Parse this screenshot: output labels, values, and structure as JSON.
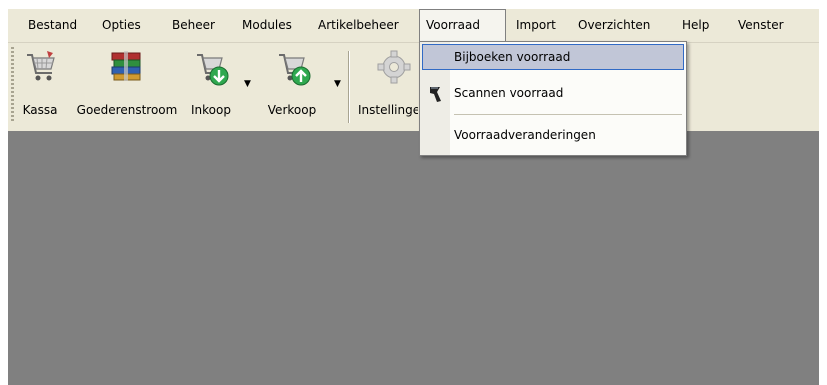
{
  "menubar": {
    "items": [
      {
        "label": "Bestand"
      },
      {
        "label": "Opties"
      },
      {
        "label": "Beheer"
      },
      {
        "label": "Modules"
      },
      {
        "label": "Artikelbeheer"
      },
      {
        "label": "Voorraad"
      },
      {
        "label": "Import"
      },
      {
        "label": "Overzichten"
      },
      {
        "label": "Help"
      },
      {
        "label": "Venster"
      }
    ],
    "open_menu": "Voorraad"
  },
  "toolbar": {
    "buttons": [
      {
        "label": "Kassa",
        "icon": "shopping-cart-icon"
      },
      {
        "label": "Goederenstroom",
        "icon": "stacked-books-icon"
      },
      {
        "label": "Inkoop",
        "icon": "cart-download-icon",
        "has_dropdown": true
      },
      {
        "label": "Verkoop",
        "icon": "cart-upload-icon",
        "has_dropdown": true
      },
      {
        "label": "Instellinge",
        "icon": "gear-icon"
      }
    ]
  },
  "dropdown": {
    "items": [
      {
        "label": "Bijboeken voorraad",
        "highlighted": true
      },
      {
        "label": "Scannen voorraad",
        "icon": "barcode-scanner-icon"
      },
      {
        "label": "Voorraadveranderingen"
      }
    ]
  },
  "colors": {
    "menubar_bg": "#ece9d8",
    "workspace_bg": "#808080",
    "highlight_bg": "#c1c6d7",
    "highlight_border": "#316ac5"
  }
}
